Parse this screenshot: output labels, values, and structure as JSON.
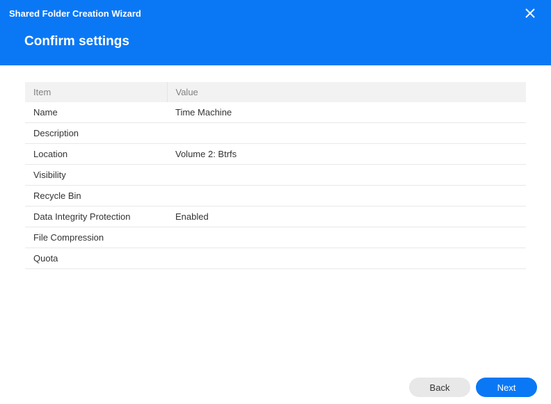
{
  "header": {
    "window_title": "Shared Folder Creation Wizard",
    "page_title": "Confirm settings"
  },
  "table": {
    "head": {
      "item": "Item",
      "value": "Value"
    },
    "rows": [
      {
        "item": "Name",
        "value": "Time Machine"
      },
      {
        "item": "Description",
        "value": ""
      },
      {
        "item": "Location",
        "value": "Volume 2: Btrfs"
      },
      {
        "item": "Visibility",
        "value": ""
      },
      {
        "item": "Recycle Bin",
        "value": ""
      },
      {
        "item": "Data Integrity Protection",
        "value": "Enabled"
      },
      {
        "item": "File Compression",
        "value": ""
      },
      {
        "item": "Quota",
        "value": ""
      }
    ]
  },
  "footer": {
    "back_label": "Back",
    "next_label": "Next"
  }
}
